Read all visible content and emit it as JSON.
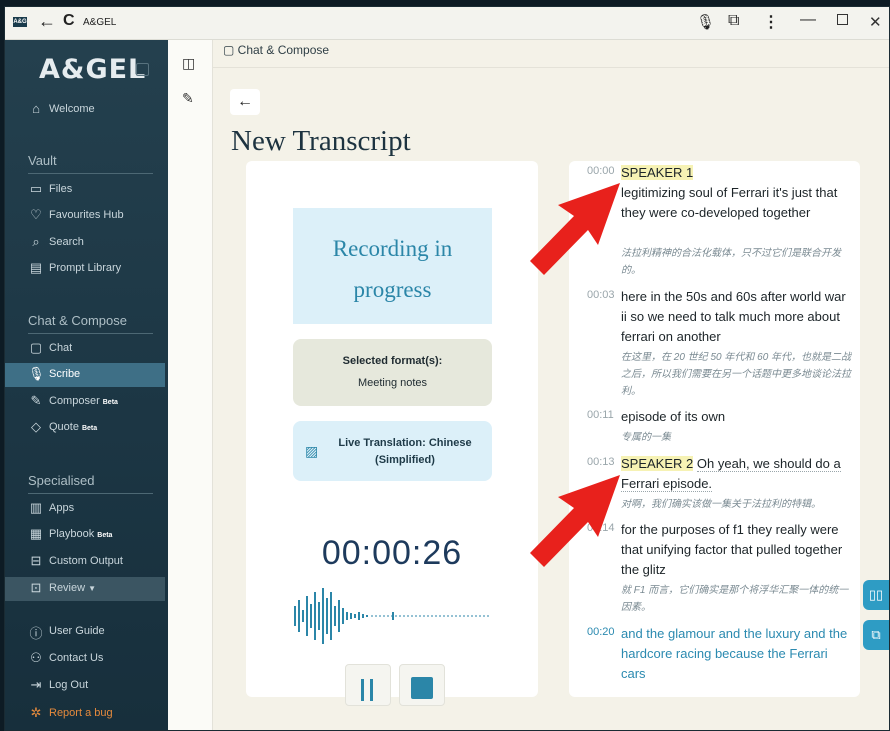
{
  "titlebar": {
    "logo_text": "A&G",
    "title": "A&GEL",
    "icons": [
      "back-arrow-icon",
      "reload-icon",
      "microphone-icon",
      "extension-icon",
      "more-vertical-icon",
      "minimize-icon",
      "maximize-icon",
      "close-icon"
    ]
  },
  "sidebar": {
    "brand": "A&GEL",
    "welcome": "Welcome",
    "vault_title": "Vault",
    "vault_items": [
      {
        "label": "Files",
        "icon": "folder-icon"
      },
      {
        "label": "Favourites Hub",
        "icon": "heart-icon"
      },
      {
        "label": "Search",
        "icon": "search-icon"
      },
      {
        "label": "Prompt Library",
        "icon": "library-icon"
      }
    ],
    "chat_title": "Chat & Compose",
    "chat_items": [
      {
        "label": "Chat",
        "icon": "chat-icon"
      },
      {
        "label": "Scribe",
        "icon": "microphone-icon",
        "active": true
      },
      {
        "label": "Composer",
        "badge": "Beta",
        "icon": "pen-icon"
      },
      {
        "label": "Quote",
        "badge": "Beta",
        "icon": "tag-icon"
      }
    ],
    "special_title": "Specialised",
    "special_items": [
      {
        "label": "Apps",
        "icon": "apps-icon"
      },
      {
        "label": "Playbook",
        "badge": "Beta",
        "icon": "book-icon"
      },
      {
        "label": "Custom Output",
        "icon": "output-icon"
      },
      {
        "label": "Review",
        "icon": "review-icon"
      }
    ],
    "bottom_items": [
      {
        "label": "User Guide",
        "icon": "info-icon"
      },
      {
        "label": "Contact Us",
        "icon": "contacts-icon"
      },
      {
        "label": "Log Out",
        "icon": "logout-icon"
      },
      {
        "label": "Report a bug",
        "icon": "bug-icon"
      }
    ]
  },
  "rail": {
    "icons": [
      "panel-toggle-icon",
      "new-chat-icon"
    ]
  },
  "main": {
    "breadcrumb": "Chat & Compose",
    "title": "New Transcript",
    "recording_status": "Recording in progress",
    "format_title": "Selected format(s):",
    "format_value": "Meeting notes",
    "translation": "Live Translation: Chinese (Simplified)",
    "timer": "00:00:26"
  },
  "transcript": [
    {
      "time": "00:00",
      "speaker": "SPEAKER 1",
      "text": "legitimizing soul of Ferrari it's just that they were co-developed together",
      "zh": "法拉利精神的合法化载体，只不过它们是联合开发的。"
    },
    {
      "time": "00:03",
      "text": "here in the 50s and 60s after world war ii so we need to talk much more about ferrari on another",
      "zh": "在这里，在 20 世纪 50 年代和 60 年代，也就是二战之后，所以我们需要在另一个话题中更多地谈论法拉利。"
    },
    {
      "time": "00:11",
      "text": "episode of its own",
      "zh": "专属的一集"
    },
    {
      "time": "00:13",
      "speaker": "SPEAKER 2",
      "text": "Oh yeah, we should do a Ferrari episode.",
      "zh": "对啊，我们确实该做一集关于法拉利的特辑。"
    },
    {
      "time": "00:14",
      "text": "for the purposes of f1 they really were that unifying factor that pulled together the glitz",
      "zh": "就 F1 而言，它们确实是那个将浮华汇聚一体的统一因素。"
    },
    {
      "time": "00:20",
      "text": "and the glamour and the luxury and the hardcore racing because the Ferrari cars",
      "live": true
    }
  ],
  "float_icons": [
    "book-open-icon",
    "copy-icon"
  ],
  "colors": {
    "accent": "#2b86a8",
    "sidebar": "#1c3644",
    "speaker_highlight": "#f6f2b4",
    "annotation_arrow": "#e8211c"
  }
}
